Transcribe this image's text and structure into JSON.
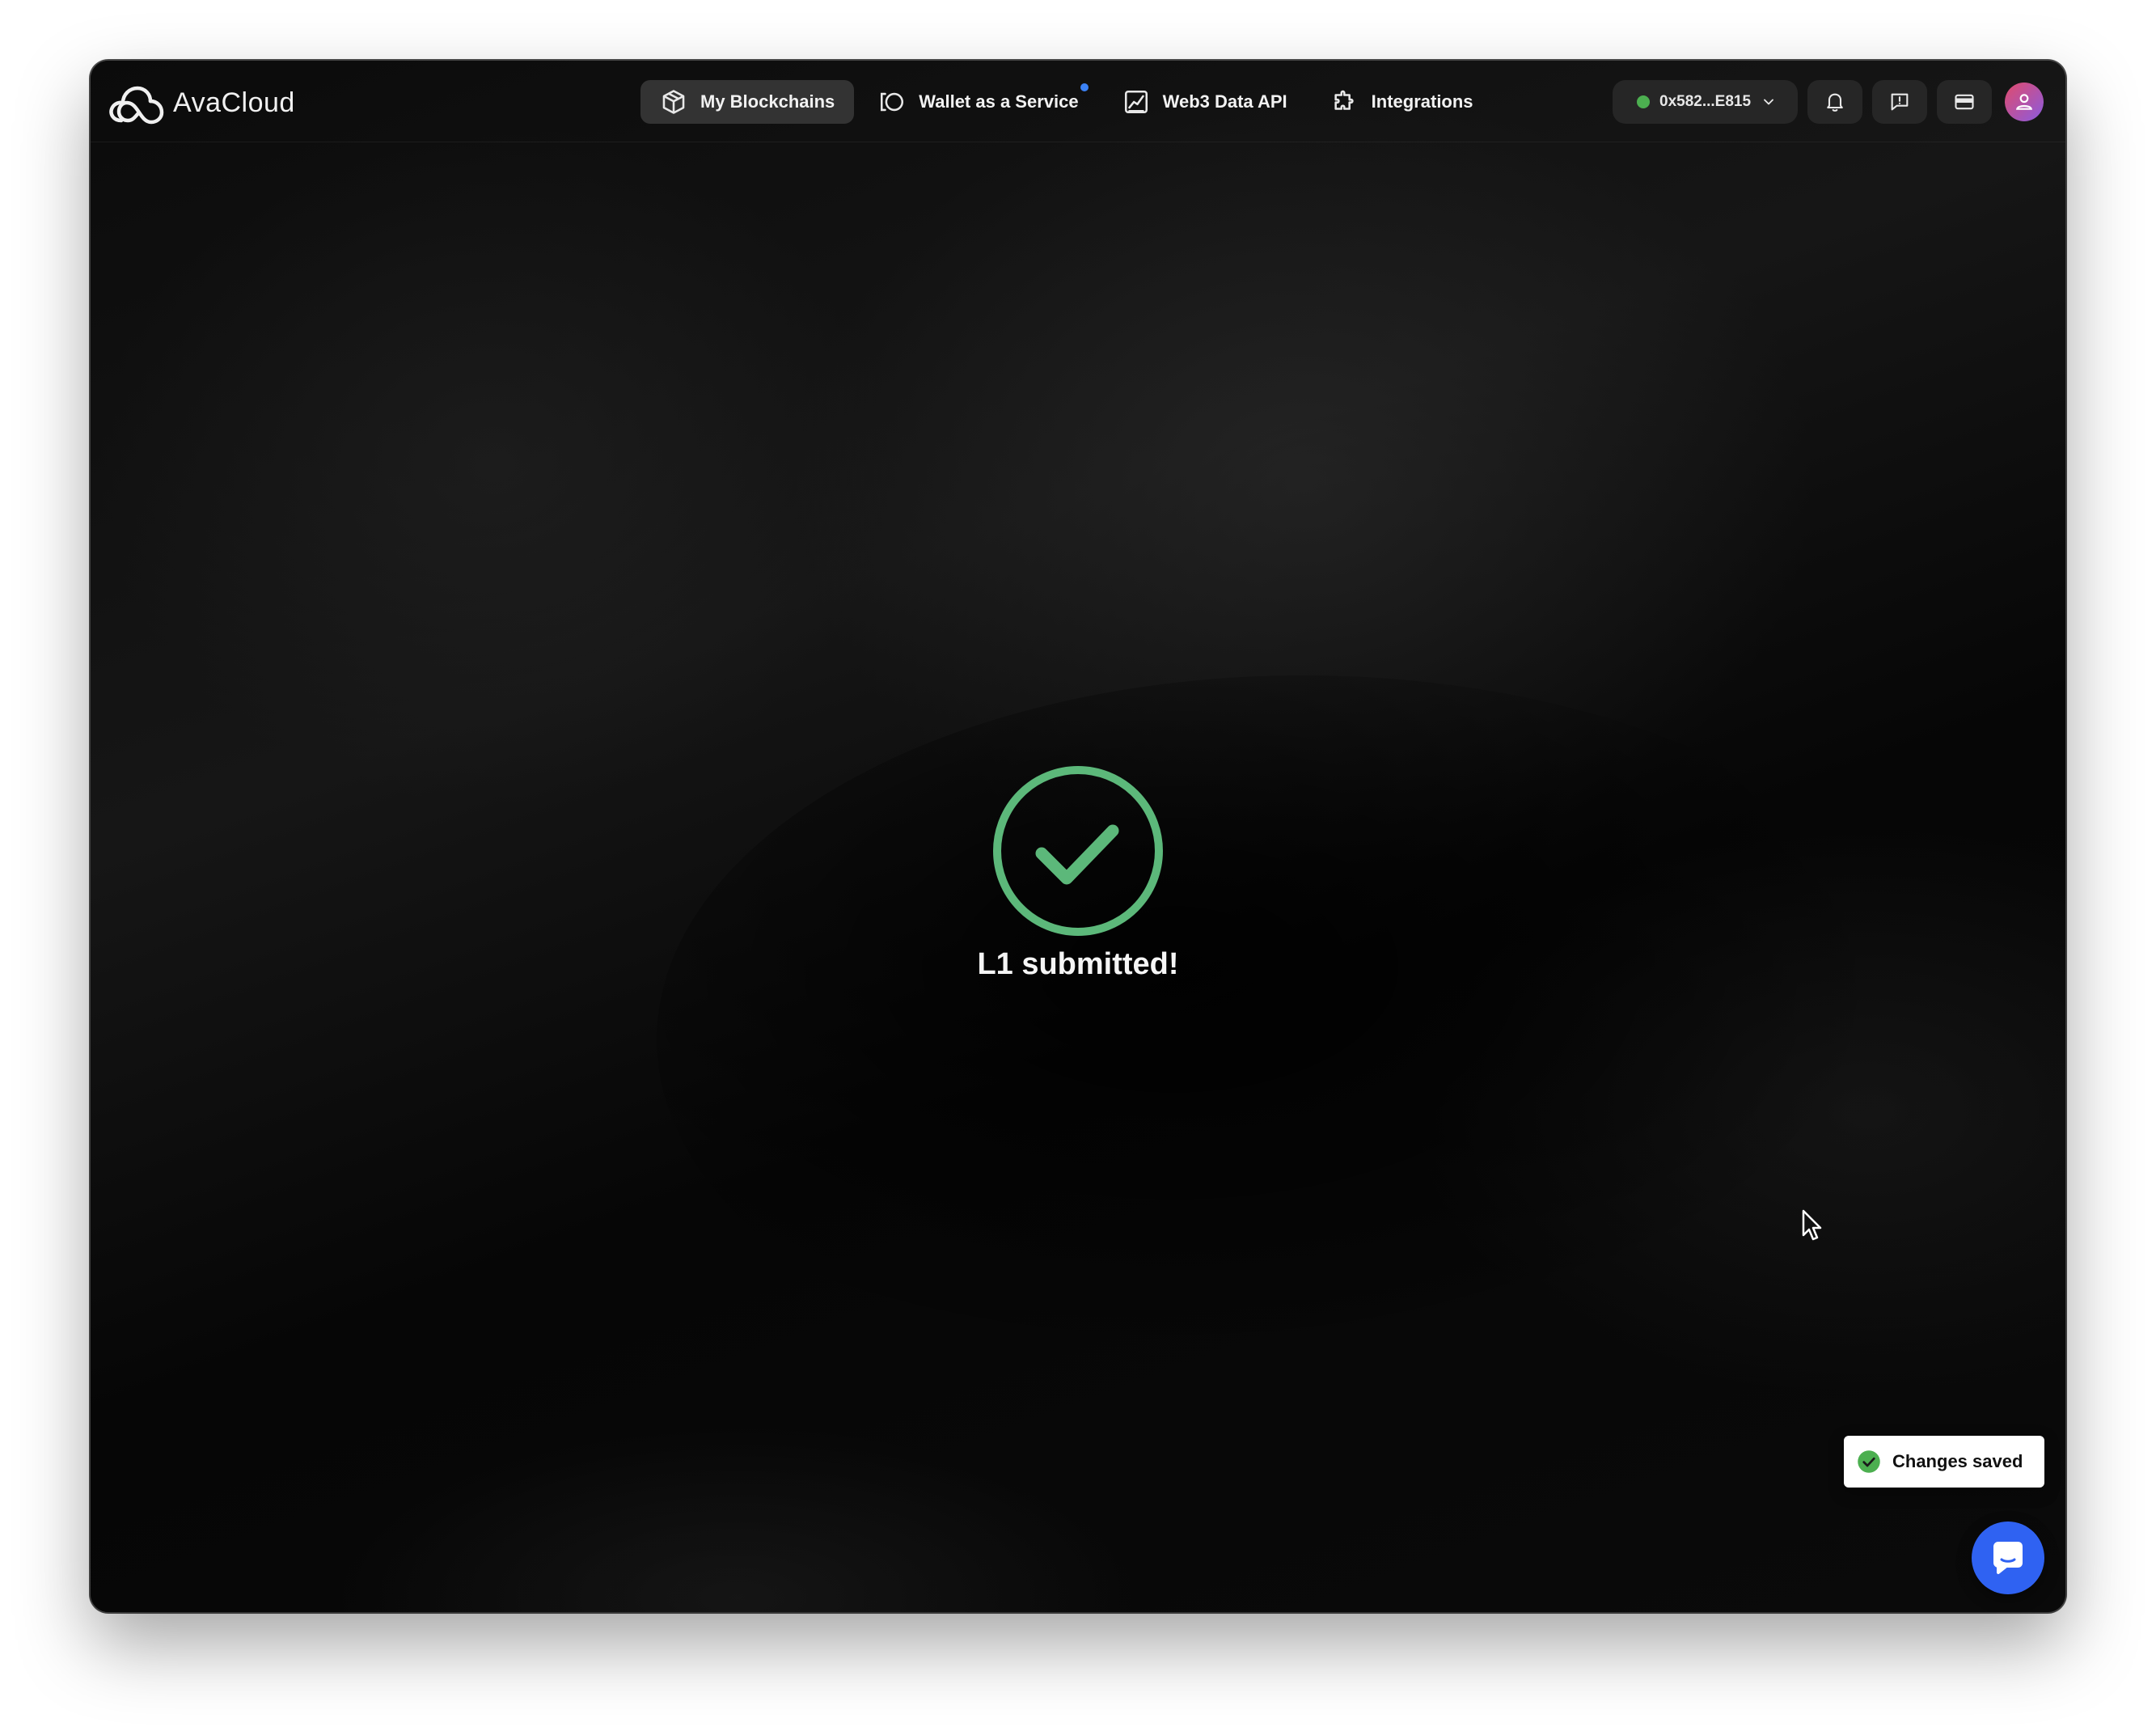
{
  "header": {
    "logo_text": "AvaCloud",
    "nav": [
      {
        "label": "My Blockchains",
        "icon": "cube-icon",
        "active": true
      },
      {
        "label": "Wallet as a Service",
        "icon": "wallet-icon",
        "active": false,
        "badge": true
      },
      {
        "label": "Web3 Data API",
        "icon": "chart-icon",
        "active": false
      },
      {
        "label": "Integrations",
        "icon": "puzzle-icon",
        "active": false
      }
    ],
    "wallet": {
      "address": "0x582...E815",
      "status_color": "#4caf50"
    },
    "tools": [
      {
        "icon": "bell-icon"
      },
      {
        "icon": "feedback-icon"
      },
      {
        "icon": "credit-card-icon"
      }
    ]
  },
  "main": {
    "success_title": "L1 submitted!",
    "success_color": "#5cb87a"
  },
  "toast": {
    "label": "Changes saved",
    "icon": "check-circle-icon"
  },
  "chat": {
    "icon": "chat-bubble-icon",
    "color": "#2f62f2"
  },
  "colors": {
    "background": "#050505",
    "nav_active_bg": "#333333",
    "badge": "#3b82f6"
  }
}
